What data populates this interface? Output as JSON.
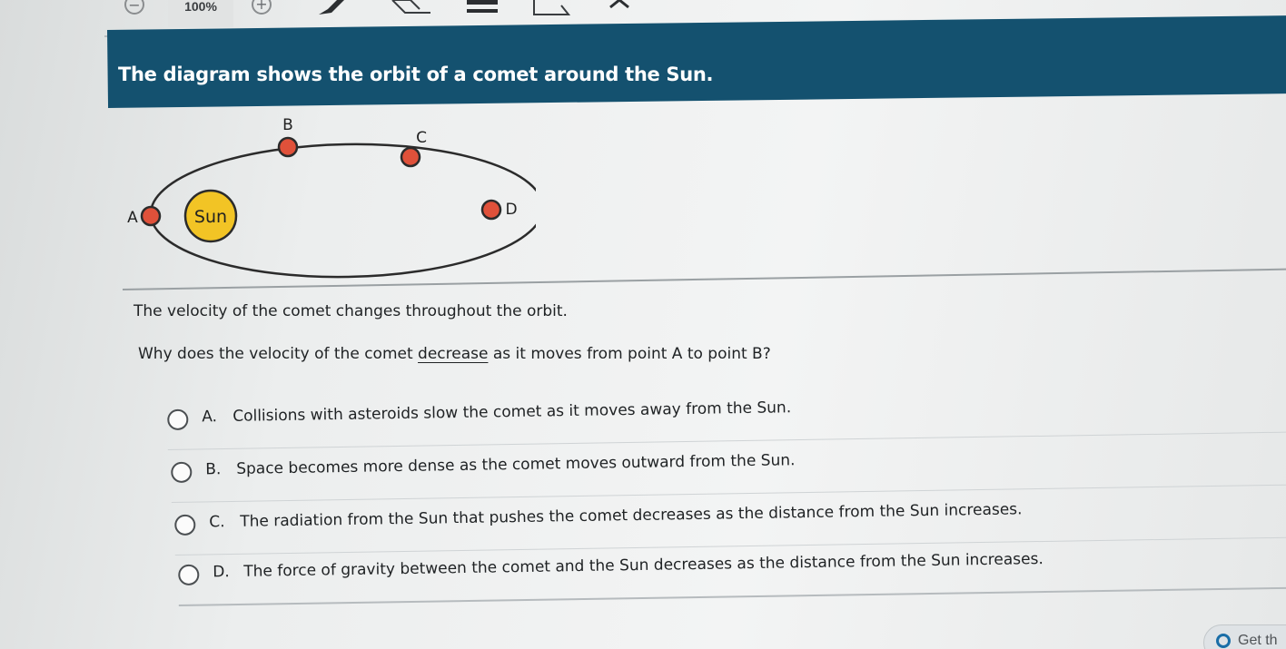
{
  "toolbar": {
    "zoom_out_symbol": "−",
    "zoom_level": "100%",
    "zoom_in_symbol": "+",
    "tools": [
      "pencil-icon",
      "eraser-icon",
      "highlighter-icon",
      "line-reader-icon",
      "collapse-icon"
    ]
  },
  "header": {
    "title": "The diagram shows the orbit of a comet around the Sun."
  },
  "diagram": {
    "sun_label": "Sun",
    "points": [
      {
        "label": "A"
      },
      {
        "label": "B"
      },
      {
        "label": "C"
      },
      {
        "label": "D"
      }
    ],
    "colors": {
      "orbit": "#2b2b2b",
      "comet": "#e0513a",
      "sun": "#f2c425"
    }
  },
  "stem": "The velocity of the comet changes throughout the orbit.",
  "question": {
    "before": "Why does the velocity of the comet ",
    "emphasis": "decrease",
    "after": " as it moves from point A to point B?"
  },
  "options": [
    {
      "letter": "A.",
      "text": "Collisions with asteroids slow the comet as it moves away from the Sun."
    },
    {
      "letter": "B.",
      "text": "Space becomes more dense as the comet moves outward from the Sun."
    },
    {
      "letter": "C.",
      "text": "The radiation from the Sun that pushes the comet decreases as the distance from the Sun increases."
    },
    {
      "letter": "D.",
      "text": "The force of gravity between the comet and the Sun decreases as the distance from the Sun increases."
    }
  ],
  "footer": {
    "button_label": "Get th"
  },
  "colors": {
    "header_band": "#14516f",
    "accent": "#1a6ea7"
  }
}
